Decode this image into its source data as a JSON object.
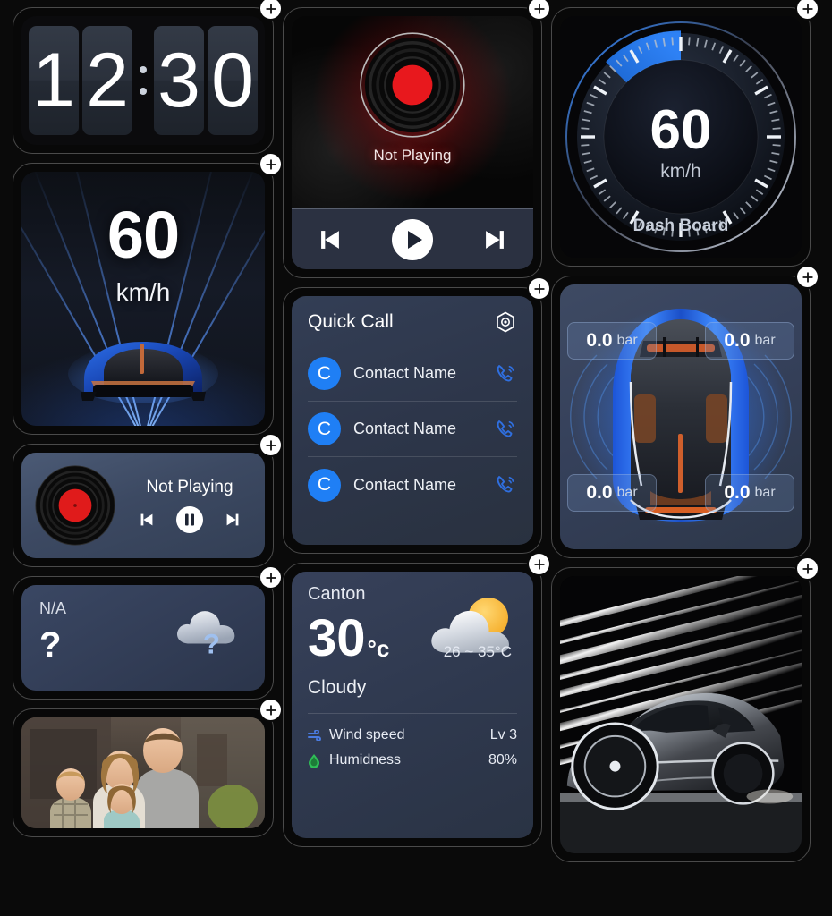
{
  "add_button": {
    "label": "+",
    "icon": "plus-icon"
  },
  "clock": {
    "digits": [
      "1",
      "2",
      "3",
      "0"
    ],
    "separator": ":",
    "time": "12:30"
  },
  "speed_widget": {
    "value": "60",
    "unit": "km/h"
  },
  "mini_media": {
    "title": "Not Playing",
    "prev_icon": "previous-track-icon",
    "play_icon": "pause-icon",
    "next_icon": "next-track-icon"
  },
  "na_widget": {
    "label": "N/A",
    "value": "?",
    "icon": "cloud-question-icon"
  },
  "family_photo": {
    "alt": "family-photo"
  },
  "media_player": {
    "title": "Not Playing",
    "prev_icon": "previous-track-icon",
    "play_icon": "play-icon",
    "next_icon": "next-track-icon",
    "album_art_icon": "vinyl-record-icon"
  },
  "quick_call": {
    "title": "Quick Call",
    "settings_icon": "hexagon-settings-icon",
    "contacts": [
      {
        "avatar": "C",
        "name": "Contact Name",
        "call_icon": "phone-call-icon"
      },
      {
        "avatar": "C",
        "name": "Contact Name",
        "call_icon": "phone-call-icon"
      },
      {
        "avatar": "C",
        "name": "Contact Name",
        "call_icon": "phone-call-icon"
      }
    ]
  },
  "weather": {
    "city": "Canton",
    "temperature": "30",
    "unit": "°c",
    "range": "26 ~ 35°C",
    "condition": "Cloudy",
    "icon": "sun-behind-cloud-icon",
    "details": [
      {
        "icon": "wind-icon",
        "label": "Wind speed",
        "value": "Lv 3",
        "color": "#4a7be0"
      },
      {
        "icon": "humidity-drop-icon",
        "label": "Humidness",
        "value": "80%",
        "color": "#2fbf57"
      }
    ]
  },
  "dashboard": {
    "value": "60",
    "unit": "km/h",
    "label": "Dash Board",
    "accent_color": "#1f6fe0"
  },
  "tire_pressure": {
    "unit": "bar",
    "tires": [
      {
        "position": "front-left",
        "value": "0.0"
      },
      {
        "position": "front-right",
        "value": "0.0"
      },
      {
        "position": "rear-left",
        "value": "0.0"
      },
      {
        "position": "rear-right",
        "value": "0.0"
      }
    ]
  },
  "sport_photo": {
    "alt": "sports-car-photo"
  }
}
